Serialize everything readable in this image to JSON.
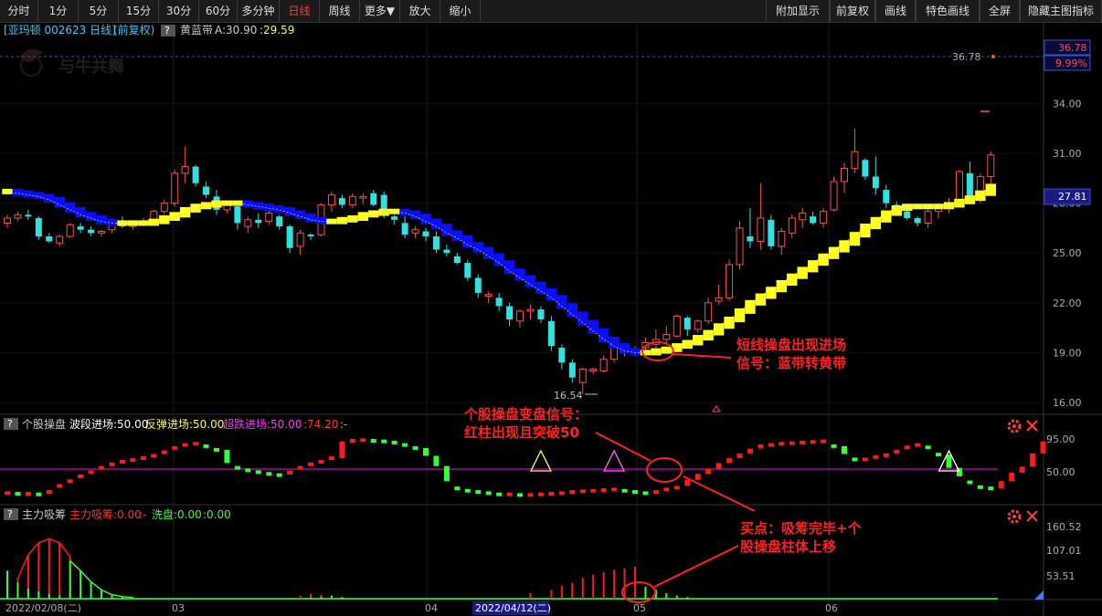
{
  "toolbar": {
    "left": [
      {
        "label": "分时",
        "w": 42
      },
      {
        "label": "1分",
        "w": 44
      },
      {
        "label": "5分",
        "w": 44
      },
      {
        "label": "15分",
        "w": 44
      },
      {
        "label": "30分",
        "w": 44
      },
      {
        "label": "60分",
        "w": 42
      },
      {
        "label": "多分钟",
        "w": 46
      },
      {
        "label": "日线",
        "w": 44,
        "active": true
      },
      {
        "label": "周线",
        "w": 44
      },
      {
        "label": "更多▼",
        "w": 44
      },
      {
        "label": "放大",
        "w": 44
      },
      {
        "label": "缩小",
        "w": 44
      }
    ],
    "right": [
      {
        "label": "附加显示",
        "w": 70
      },
      {
        "label": "前复权",
        "w": 50
      },
      {
        "label": "画线",
        "w": 44
      },
      {
        "label": "特色画线",
        "w": 70
      },
      {
        "label": "全屏",
        "w": 44
      },
      {
        "label": "隐藏主图指标",
        "w": 90
      }
    ]
  },
  "main_header": {
    "stock": "[亚玛顿 002623 日线]",
    "adjust": "(前复权)",
    "help": "?",
    "indicator": "黄蓝带",
    "a_label": "A:30.90",
    "a_value": ":29.59"
  },
  "watermark": "与牛共舞",
  "price_axis": {
    "ticks": [
      "34.00",
      "31.00",
      "28.00",
      "25.00",
      "22.00",
      "19.00",
      "16.00"
    ],
    "current_price": "27.81",
    "limit_price": "36.78",
    "limit_pct": "9.99%"
  },
  "high_label": "36.78",
  "low_label": "16.54",
  "sub1_header": {
    "help": "?",
    "name": "个股操盘",
    "p1": "波段进场:50.00",
    "p2": "反弹进场:50.00",
    "p3": "超跌进场:50.00",
    "p4": ":74.20",
    "p5": ":-"
  },
  "sub1_axis": [
    "95.00",
    "50.00"
  ],
  "sub2_header": {
    "help": "?",
    "name": "主力吸筹",
    "p1": "主力吸筹:0.00",
    "p2": ":-",
    "p3": "洗盘:0.00",
    "p4": ":0.00"
  },
  "sub2_axis": [
    "160.52",
    "107.01",
    "53.51"
  ],
  "date_axis": {
    "start": "2022/02/08(二)",
    "m03": "03",
    "m04": "04",
    "cursor": "2022/04/12(二)",
    "m05": "05",
    "m06": "06"
  },
  "annotations": {
    "a1_line1": "短线操盘出现进场",
    "a1_line2": "信号：蓝带转黄带",
    "a2_line1": "个股操盘变盘信号：",
    "a2_line2": "红柱出现且突破50",
    "a3_line1": "买点：吸筹完毕+个",
    "a3_line2": "股操盘柱体上移"
  },
  "colors": {
    "up": "#ff4d4d",
    "down": "#33e0e0",
    "band_yellow": "#ffff1a",
    "band_blue": "#0a10ff",
    "magenta": "#ff00ff",
    "annotation": "#ff2020",
    "sub_green": "#33ff33",
    "sub_red": "#ff1a1a"
  },
  "candles": [
    [
      26.8,
      27.3,
      26.5,
      27.1
    ],
    [
      27.1,
      27.5,
      26.9,
      27.3
    ],
    [
      27.3,
      27.6,
      27.0,
      27.2
    ],
    [
      27.1,
      27.2,
      25.8,
      26.0
    ],
    [
      26.0,
      26.2,
      25.6,
      25.7
    ],
    [
      25.6,
      26.1,
      25.4,
      26.0
    ],
    [
      26.0,
      26.8,
      25.9,
      26.7
    ],
    [
      26.6,
      26.8,
      26.2,
      26.4
    ],
    [
      26.4,
      26.6,
      26.0,
      26.2
    ],
    [
      26.2,
      26.4,
      26.0,
      26.3
    ],
    [
      26.4,
      27.0,
      26.2,
      26.9
    ],
    [
      26.9,
      27.2,
      26.5,
      26.6
    ],
    [
      26.6,
      26.9,
      26.4,
      26.8
    ],
    [
      26.8,
      27.1,
      26.6,
      26.9
    ],
    [
      26.9,
      27.6,
      26.8,
      27.5
    ],
    [
      27.5,
      28.2,
      27.3,
      28.0
    ],
    [
      28.0,
      30.0,
      27.8,
      29.8
    ],
    [
      29.8,
      31.4,
      29.2,
      30.2
    ],
    [
      30.2,
      30.3,
      29.0,
      29.2
    ],
    [
      29.0,
      29.3,
      28.3,
      28.5
    ],
    [
      28.4,
      28.8,
      27.3,
      27.6
    ],
    [
      27.6,
      28.1,
      27.4,
      28.0
    ],
    [
      27.8,
      28.0,
      26.4,
      26.8
    ],
    [
      26.6,
      27.2,
      26.2,
      27.0
    ],
    [
      27.0,
      27.4,
      26.5,
      26.8
    ],
    [
      26.9,
      27.6,
      26.7,
      27.4
    ],
    [
      27.2,
      27.3,
      26.4,
      26.6
    ],
    [
      26.6,
      26.7,
      25.0,
      25.3
    ],
    [
      25.4,
      26.4,
      24.9,
      26.2
    ],
    [
      26.1,
      26.2,
      25.8,
      26.0
    ],
    [
      26.1,
      28.0,
      26.0,
      27.9
    ],
    [
      27.9,
      28.7,
      27.5,
      28.5
    ],
    [
      28.3,
      28.5,
      27.7,
      27.9
    ],
    [
      27.9,
      28.6,
      27.7,
      28.4
    ],
    [
      28.3,
      28.6,
      27.9,
      28.4
    ],
    [
      28.6,
      28.8,
      27.8,
      27.9
    ],
    [
      28.5,
      28.7,
      27.1,
      27.3
    ],
    [
      27.2,
      27.3,
      26.7,
      27.0
    ],
    [
      26.8,
      27.2,
      25.9,
      26.1
    ],
    [
      26.2,
      26.6,
      25.9,
      26.4
    ],
    [
      26.3,
      26.5,
      25.7,
      26.0
    ],
    [
      26.0,
      26.3,
      25.0,
      25.2
    ],
    [
      25.2,
      25.5,
      24.8,
      25.0
    ],
    [
      24.8,
      25.0,
      24.3,
      24.4
    ],
    [
      24.4,
      24.6,
      23.3,
      23.5
    ],
    [
      23.5,
      23.7,
      22.3,
      22.6
    ],
    [
      22.4,
      22.7,
      22.0,
      22.5
    ],
    [
      22.3,
      22.6,
      21.5,
      21.8
    ],
    [
      21.8,
      22.0,
      20.6,
      21.0
    ],
    [
      20.9,
      21.6,
      20.5,
      21.5
    ],
    [
      21.5,
      21.9,
      21.0,
      21.6
    ],
    [
      21.6,
      21.8,
      20.8,
      21.0
    ],
    [
      20.9,
      21.2,
      19.1,
      19.4
    ],
    [
      19.3,
      19.5,
      18.0,
      18.4
    ],
    [
      18.4,
      18.6,
      17.2,
      17.5
    ],
    [
      17.2,
      18.1,
      16.5,
      18.0
    ],
    [
      17.9,
      18.1,
      17.7,
      18.0
    ],
    [
      17.9,
      18.8,
      17.8,
      18.6
    ],
    [
      18.6,
      19.4,
      18.4,
      19.3
    ],
    [
      19.2,
      19.4,
      18.8,
      19.0
    ],
    [
      18.9,
      19.4,
      18.8,
      19.2
    ],
    [
      19.3,
      19.9,
      19.1,
      19.6
    ],
    [
      19.5,
      20.4,
      19.2,
      19.8
    ],
    [
      19.8,
      20.6,
      19.5,
      20.1
    ],
    [
      20.0,
      21.3,
      19.9,
      21.2
    ],
    [
      21.1,
      21.2,
      20.0,
      20.4
    ],
    [
      20.4,
      21.0,
      20.2,
      20.9
    ],
    [
      20.9,
      22.3,
      20.7,
      22.0
    ],
    [
      22.1,
      23.1,
      21.9,
      22.3
    ],
    [
      22.3,
      24.6,
      22.1,
      24.3
    ],
    [
      24.3,
      26.9,
      24.0,
      26.5
    ],
    [
      26.0,
      27.7,
      25.3,
      25.7
    ],
    [
      25.7,
      29.2,
      25.2,
      27.1
    ],
    [
      27.0,
      27.3,
      25.2,
      25.4
    ],
    [
      25.4,
      26.5,
      24.9,
      26.3
    ],
    [
      26.2,
      27.3,
      25.9,
      27.1
    ],
    [
      27.0,
      27.7,
      26.5,
      27.4
    ],
    [
      27.2,
      27.5,
      26.7,
      26.8
    ],
    [
      26.8,
      27.7,
      26.5,
      27.5
    ],
    [
      27.6,
      29.6,
      27.5,
      29.3
    ],
    [
      29.3,
      30.4,
      28.6,
      30.1
    ],
    [
      30.1,
      32.5,
      29.8,
      31.1
    ],
    [
      30.6,
      30.7,
      29.4,
      29.6
    ],
    [
      29.6,
      30.8,
      28.5,
      28.9
    ],
    [
      28.8,
      29.1,
      27.7,
      28.0
    ],
    [
      27.9,
      28.1,
      27.3,
      27.5
    ],
    [
      27.5,
      27.6,
      27.0,
      27.1
    ],
    [
      27.1,
      27.2,
      26.6,
      26.8
    ],
    [
      26.8,
      27.8,
      26.5,
      27.5
    ],
    [
      27.5,
      28.0,
      27.1,
      27.7
    ],
    [
      27.7,
      28.3,
      27.4,
      28.0
    ],
    [
      28.0,
      30.0,
      27.9,
      29.9
    ],
    [
      29.8,
      30.5,
      28.0,
      28.3
    ],
    [
      28.3,
      29.8,
      28.0,
      29.6
    ],
    [
      29.6,
      31.1,
      28.7,
      30.9
    ]
  ],
  "band": [
    28.7,
    28.6,
    28.5,
    28.4,
    28.2,
    27.9,
    27.6,
    27.3,
    27.1,
    26.9,
    26.8,
    26.8,
    26.8,
    26.8,
    26.9,
    27.1,
    27.3,
    27.6,
    27.8,
    27.9,
    28.0,
    28.0,
    28.0,
    27.9,
    27.8,
    27.7,
    27.6,
    27.4,
    27.2,
    27.0,
    26.9,
    26.9,
    27.0,
    27.1,
    27.3,
    27.4,
    27.5,
    27.5,
    27.4,
    27.2,
    26.9,
    26.6,
    26.2,
    25.9,
    25.5,
    25.2,
    24.8,
    24.4,
    23.9,
    23.5,
    23.1,
    22.7,
    22.3,
    21.8,
    21.3,
    20.8,
    20.3,
    19.8,
    19.4,
    19.1,
    19.0,
    19.0,
    19.1,
    19.2,
    19.4,
    19.6,
    19.9,
    20.2,
    20.6,
    21.0,
    21.5,
    22.0,
    22.4,
    22.8,
    23.2,
    23.6,
    24.0,
    24.4,
    24.8,
    25.2,
    25.6,
    26.1,
    26.6,
    27.0,
    27.4,
    27.7,
    27.8,
    27.8,
    27.8,
    27.8,
    27.9,
    28.1,
    28.3,
    28.6,
    29.0
  ],
  "sub1_values": [
    10,
    9,
    9,
    8,
    12,
    22,
    30,
    38,
    45,
    52,
    58,
    62,
    65,
    68,
    72,
    78,
    85,
    90,
    92,
    88,
    82,
    60,
    52,
    48,
    45,
    42,
    40,
    44,
    52,
    58,
    62,
    68,
    96,
    97,
    98,
    97,
    96,
    94,
    90,
    85,
    72,
    55,
    30,
    18,
    14,
    12,
    10,
    8,
    8,
    7,
    7,
    8,
    9,
    10,
    12,
    13,
    14,
    15,
    16,
    14,
    12,
    10,
    12,
    16,
    22,
    32,
    42,
    50,
    60,
    68,
    76,
    84,
    88,
    90,
    92,
    93,
    94,
    95,
    96,
    88,
    75,
    66,
    66,
    70,
    76,
    82,
    86,
    90,
    86,
    74,
    52,
    38,
    28,
    20,
    18,
    30,
    44,
    54,
    76,
    96
  ],
  "sub1_red_start": 64,
  "triangles": [
    {
      "i": 51,
      "color": "#ffff33"
    },
    {
      "i": 58,
      "color": "#ff66ff"
    },
    {
      "i": 90,
      "color": "#ffffff"
    }
  ],
  "sub2_red": [
    [
      1,
      50
    ],
    [
      2,
      110
    ],
    [
      3,
      140
    ],
    [
      4,
      150
    ],
    [
      5,
      140
    ],
    [
      6,
      105
    ],
    [
      28,
      8
    ],
    [
      29,
      12
    ],
    [
      30,
      10
    ],
    [
      50,
      14
    ],
    [
      52,
      22
    ],
    [
      53,
      32
    ],
    [
      54,
      40
    ],
    [
      55,
      52
    ],
    [
      56,
      60
    ],
    [
      57,
      66
    ],
    [
      58,
      72
    ],
    [
      59,
      76
    ],
    [
      60,
      80
    ]
  ],
  "sub2_green": [
    [
      0,
      70
    ],
    [
      1,
      40
    ],
    [
      2,
      25
    ],
    [
      3,
      18
    ],
    [
      4,
      12
    ],
    [
      5,
      8
    ],
    [
      6,
      95
    ],
    [
      7,
      70
    ],
    [
      8,
      42
    ],
    [
      9,
      22
    ],
    [
      10,
      10
    ],
    [
      11,
      5
    ],
    [
      12,
      3
    ],
    [
      29,
      3
    ],
    [
      30,
      4
    ],
    [
      31,
      8
    ],
    [
      32,
      4
    ],
    [
      61,
      30
    ],
    [
      62,
      22
    ],
    [
      63,
      14
    ],
    [
      64,
      8
    ],
    [
      65,
      4
    ]
  ]
}
